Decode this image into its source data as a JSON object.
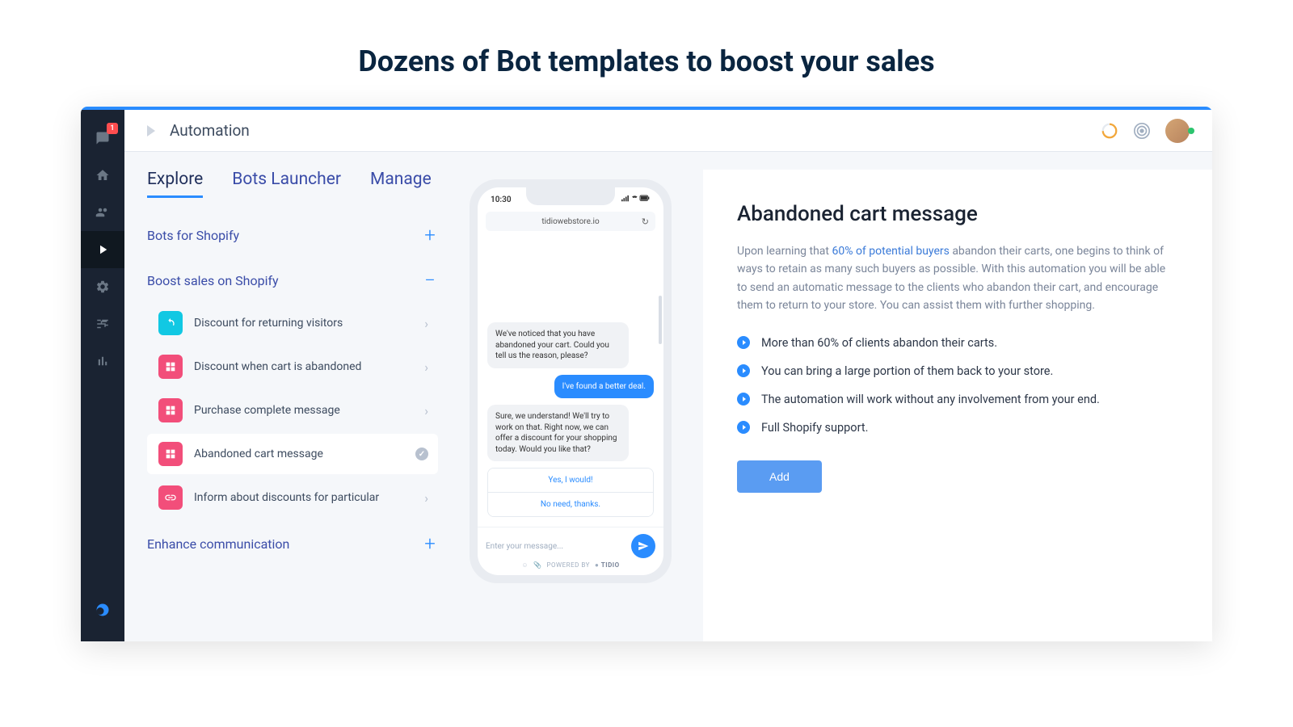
{
  "page": {
    "main_title": "Dozens of Bot templates to boost your sales"
  },
  "sidebar": {
    "chat_badge": "1"
  },
  "header": {
    "title": "Automation"
  },
  "tabs": {
    "explore": "Explore",
    "launcher": "Bots Launcher",
    "manage": "Manage"
  },
  "categories": {
    "shopify": {
      "label": "Bots for Shopify",
      "toggle": "+"
    },
    "boost": {
      "label": "Boost sales on Shopify",
      "toggle": "−"
    },
    "enhance": {
      "label": "Enhance communication",
      "toggle": "+"
    }
  },
  "bots": {
    "returning": "Discount for returning visitors",
    "abandoned_disc": "Discount when cart is abandoned",
    "purchase": "Purchase complete message",
    "abandoned_msg": "Abandoned cart message",
    "inform": "Inform about discounts for particular"
  },
  "phone": {
    "time": "10:30",
    "url": "tidiowebstore.io",
    "msg1": "We've noticed that you have abandoned your cart. Could you tell us the reason, please?",
    "msg2": "I've found  a better deal.",
    "msg3": "Sure, we understand! We'll try to work on that. Right now, we can offer a discount for your shopping today. Would you like that?",
    "qr1": "Yes, I would!",
    "qr2": "No need, thanks.",
    "placeholder": "Enter your message...",
    "powered": "POWERED BY",
    "brand": "TIDIO"
  },
  "detail": {
    "title": "Abandoned cart message",
    "desc_pre": "Upon learning that ",
    "desc_hl": "60% of potential buyers",
    "desc_post": " abandon their carts, one begins to think of ways to retain as many such buyers as possible. With this automation you will be able to send an automatic message to the clients who abandon their cart, and encourage them to return to your store. You can assist them with further shopping.",
    "b1": "More than 60% of clients abandon their carts.",
    "b2": "You can bring a large portion of them back to your store.",
    "b3": "The automation will work without any involvement from your end.",
    "b4": "Full Shopify support.",
    "add": "Add"
  }
}
